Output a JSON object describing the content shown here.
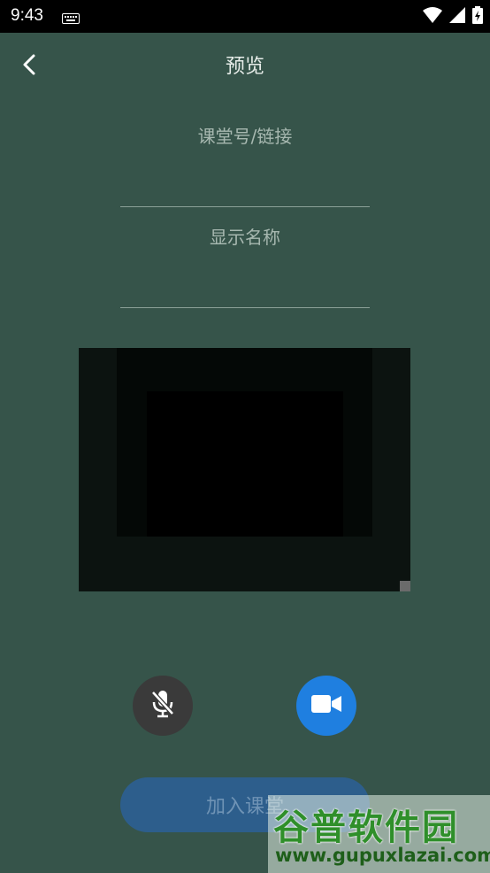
{
  "status_bar": {
    "time": "9:43",
    "icons": [
      "keyboard-icon",
      "wifi-icon",
      "signal-icon",
      "battery-icon"
    ]
  },
  "header": {
    "title": "预览",
    "back_icon": "chevron-left-icon"
  },
  "form": {
    "room_placeholder": "课堂号/链接",
    "name_placeholder": "显示名称"
  },
  "controls": {
    "mic_icon": "mic-muted-icon",
    "camera_icon": "video-camera-icon",
    "camera_color": "#1f7fe0",
    "mic_color": "#3a3a3a"
  },
  "join_button": {
    "label": "加入课堂"
  },
  "watermark": {
    "brand": "谷普软件园",
    "url": "www.gupuxlazai.com"
  },
  "colors": {
    "background": "#36544a",
    "join_button": "#2d5e8c"
  }
}
